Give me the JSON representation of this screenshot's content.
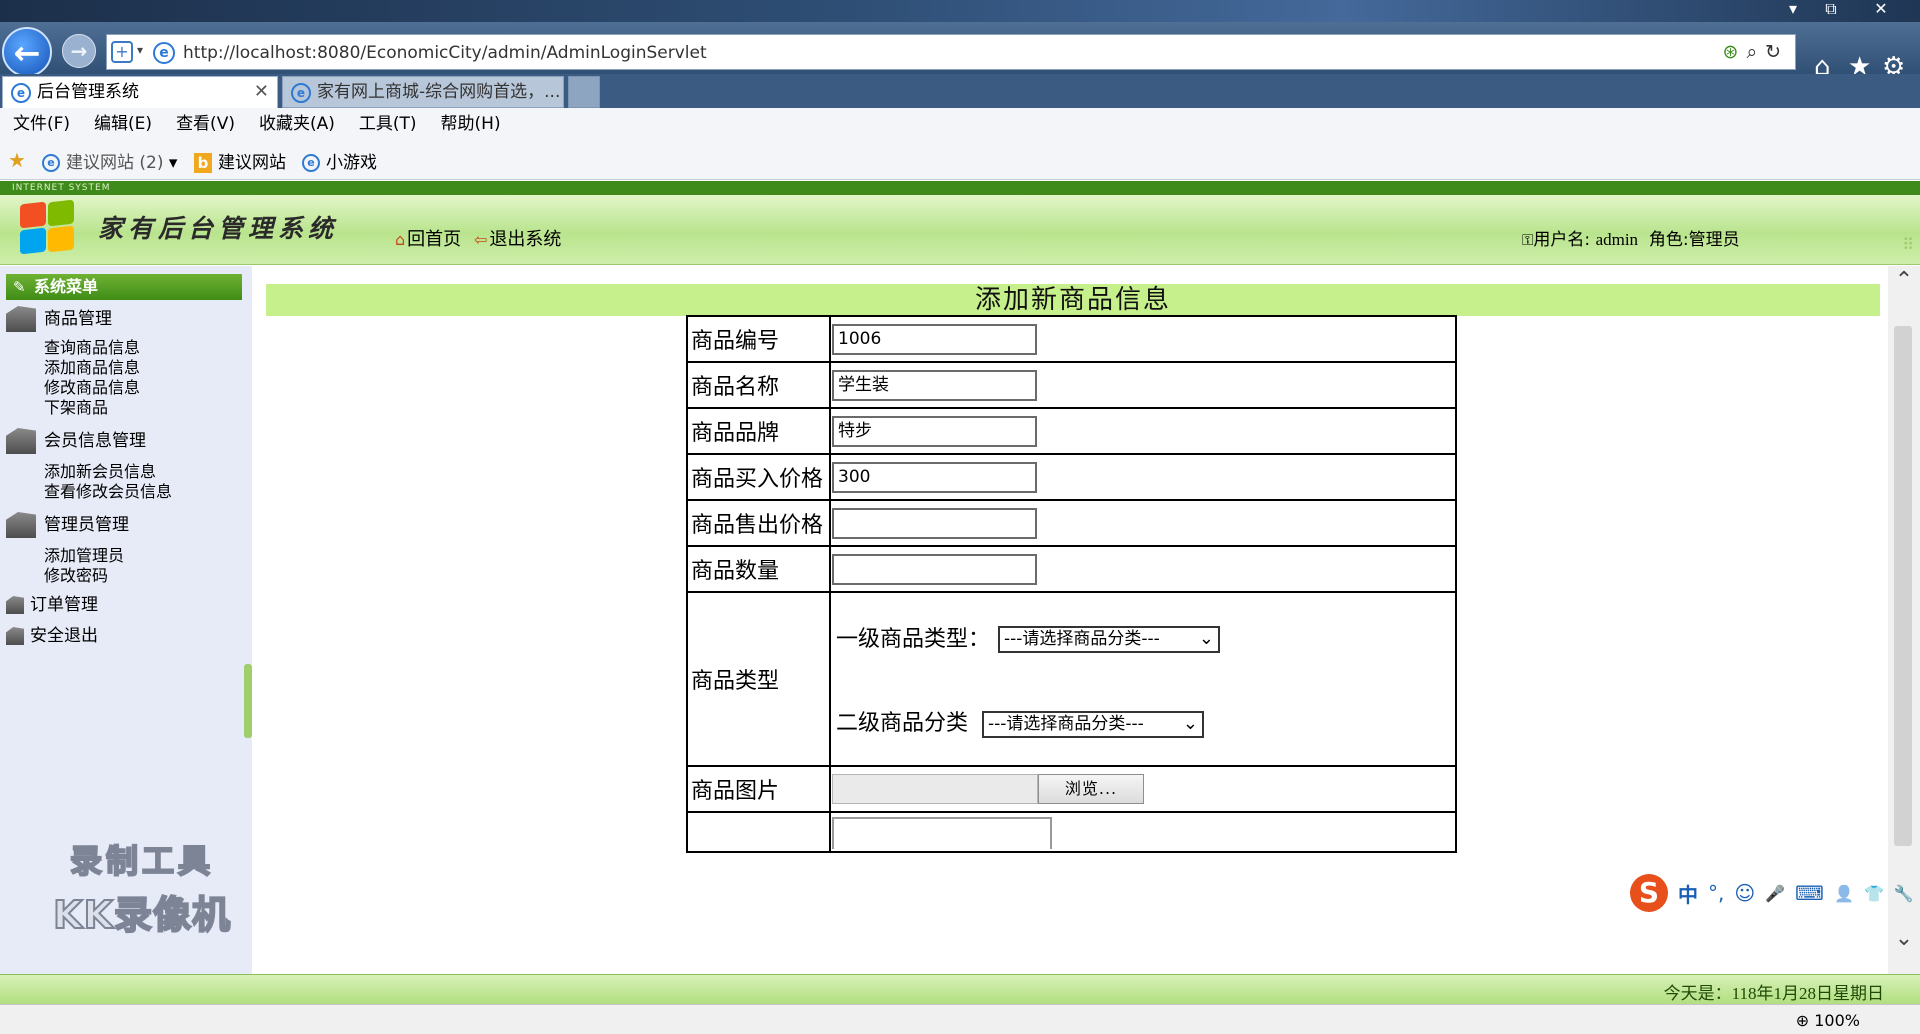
{
  "browser": {
    "url": "http://localhost:8080/EconomicCity/admin/AdminLoginServlet",
    "url_host": "localhost",
    "tabs": [
      {
        "label": "后台管理系统",
        "active": true
      },
      {
        "label": "家有网上商城-综合网购首选，...",
        "active": false
      }
    ],
    "menu": [
      "文件(F)",
      "编辑(E)",
      "查看(V)",
      "收藏夹(A)",
      "工具(T)",
      "帮助(H)"
    ],
    "favorites": [
      {
        "label": "建议网站 (2)",
        "icon": "ie-icon"
      },
      {
        "label": "建议网站",
        "icon": "bing-icon"
      },
      {
        "label": "小游戏",
        "icon": "ie-icon"
      }
    ],
    "zoom": "100%"
  },
  "header": {
    "strip_text": "INTERNET SYSTEM",
    "title": "家有后台管理系统",
    "home_link": "回首页",
    "logout_link": "退出系统",
    "user_label": "用户名:",
    "user_name": "admin",
    "role_label": "角色:",
    "role_name": "管理员"
  },
  "sidebar": {
    "heading": "系统菜单",
    "groups": [
      {
        "label": "商品管理",
        "items": [
          "查询商品信息",
          "添加商品信息",
          "修改商品信息",
          "下架商品"
        ]
      },
      {
        "label": "会员信息管理",
        "items": [
          "添加新会员信息",
          "查看修改会员信息"
        ]
      },
      {
        "label": "管理员管理",
        "items": [
          "添加管理员",
          "修改密码"
        ]
      },
      {
        "label": "订单管理",
        "items": []
      },
      {
        "label": "安全退出",
        "items": []
      }
    ],
    "watermark_line1": "录制工具",
    "watermark_line2": "KK录像机"
  },
  "form": {
    "title": "添加新商品信息",
    "fields": [
      {
        "label": "商品编号",
        "value": "1006"
      },
      {
        "label": "商品名称",
        "value": "学生装"
      },
      {
        "label": "商品品牌",
        "value": "特步"
      },
      {
        "label": "商品买入价格",
        "value": "300"
      },
      {
        "label": "商品售出价格",
        "value": ""
      },
      {
        "label": "商品数量",
        "value": ""
      }
    ],
    "type_label": "商品类型",
    "level1_label": "一级商品类型：",
    "level2_label": "二级商品分类",
    "select_placeholder": "---请选择商品分类---",
    "image_label": "商品图片",
    "browse_button": "浏览..."
  },
  "ime": {
    "items": [
      "中",
      "°,",
      "☺",
      "🎤",
      "⌨",
      "👤",
      "👕",
      "🔧"
    ]
  },
  "footer": {
    "date_prefix": "今天是：",
    "date_text": "118年1月28日星期日"
  },
  "colors": {
    "accent_green": "#c6f08c",
    "header_green": "#b9e48d",
    "sidebar_bg": "#e7ebf7",
    "ie_blue": "#2e7bd6"
  }
}
